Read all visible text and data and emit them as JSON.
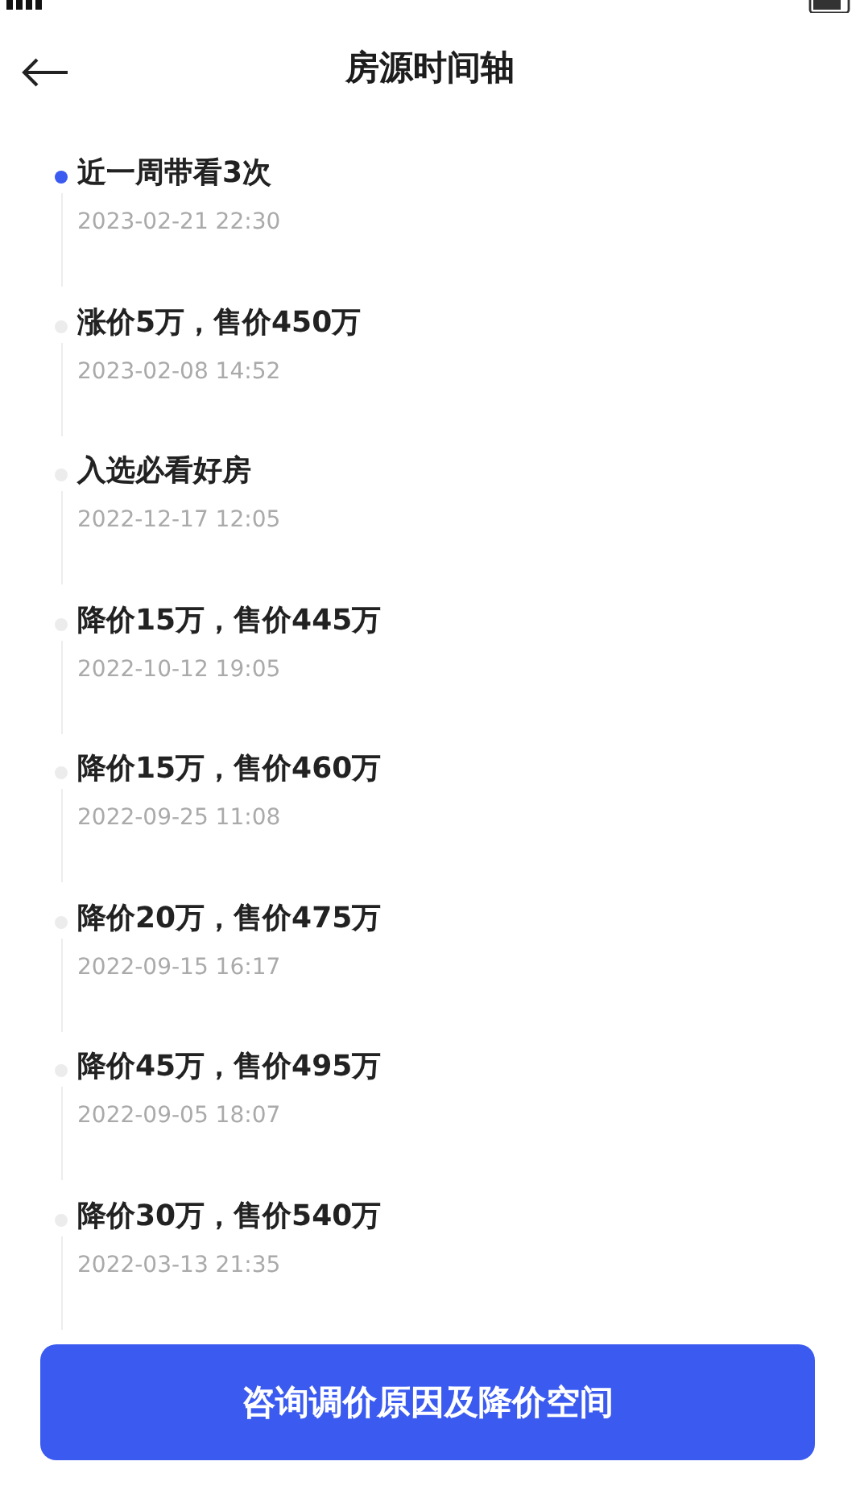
{
  "header": {
    "title": "房源时间轴"
  },
  "timeline": [
    {
      "title": "近一周带看3次",
      "time": "2023-02-21 22:30",
      "highlighted": true
    },
    {
      "title": "涨价5万，售价450万",
      "time": "2023-02-08 14:52",
      "highlighted": false
    },
    {
      "title": "入选必看好房",
      "time": "2022-12-17 12:05",
      "highlighted": false
    },
    {
      "title": "降价15万，售价445万",
      "time": "2022-10-12 19:05",
      "highlighted": false
    },
    {
      "title": "降价15万，售价460万",
      "time": "2022-09-25 11:08",
      "highlighted": false
    },
    {
      "title": "降价20万，售价475万",
      "time": "2022-09-15 16:17",
      "highlighted": false
    },
    {
      "title": "降价45万，售价495万",
      "time": "2022-09-05 18:07",
      "highlighted": false
    },
    {
      "title": "降价30万，售价540万",
      "time": "2022-03-13 21:35",
      "highlighted": false
    }
  ],
  "action_button": {
    "label": "咨询调价原因及降价空间"
  }
}
